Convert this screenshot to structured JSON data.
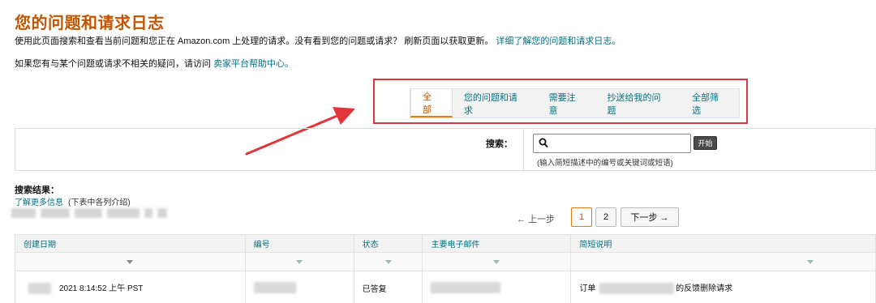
{
  "page": {
    "title": "您的问题和请求日志",
    "intro_text": "使用此页面搜索和查看当前问题和您正在 Amazon.com 上处理的请求。没有看到您的问题或请求？ 刷新页面以获取更新。",
    "intro_link": "详细了解您的问题和请求日志。",
    "help_text": "如果您有与某个问题或请求不相关的疑问，请访问",
    "help_link": "卖家平台帮助中心。"
  },
  "tabs": [
    {
      "label": "全部",
      "active": true
    },
    {
      "label": "您的问题和请求",
      "active": false
    },
    {
      "label": "需要注意",
      "active": false
    },
    {
      "label": "抄送给我的问题",
      "active": false
    },
    {
      "label": "全部筛选",
      "active": false
    }
  ],
  "search": {
    "label": "搜索：",
    "value": "",
    "button": "开始",
    "hint": "(输入简短描述中的编号或关键词或短语)",
    "icon": "search-icon"
  },
  "results": {
    "title": "搜索结果：",
    "learn_more": "了解更多信息",
    "note": "(下表中各列介绍)"
  },
  "pagination": {
    "prev": "← 上一步",
    "pages": [
      "1",
      "2"
    ],
    "current": "1",
    "next": "下一步 →"
  },
  "table": {
    "headers": [
      "创建日期",
      "编号",
      "状态",
      "主要电子邮件",
      "简短说明"
    ],
    "rows": [
      {
        "date": "2021 8:14:52 上午 PST",
        "id": "",
        "status": "已答复",
        "email": "",
        "desc_prefix": "订单",
        "desc_suffix": "的反馈删除请求"
      }
    ]
  },
  "colors": {
    "accent": "#c45500",
    "link": "#007185",
    "annotation": "#e0363b"
  }
}
